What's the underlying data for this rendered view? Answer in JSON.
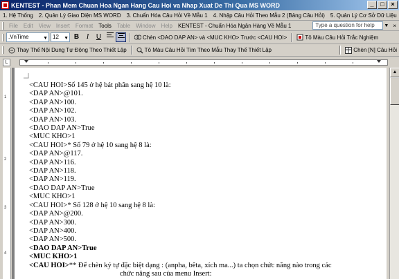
{
  "window": {
    "title": "KENTEST - Phan Mem Chuan Hoa Ngan Hang Cau Hoi va Nhap Xuat De Thi Qua MS WORD",
    "minimize": "_",
    "maximize": "□",
    "close": "×"
  },
  "menubar1": {
    "items": [
      "1. Hệ Thống",
      "2. Quản Lý Giao Diện MS WORD",
      "3. Chuẩn Hóa Câu Hỏi Về Mẫu 1",
      "4. Nhập Câu Hỏi Theo Mẫu 2 (Bảng Câu Hỏi)",
      "5. Quản Lý Cơ Sở Dữ Liệu"
    ]
  },
  "menubar2": {
    "items": [
      "File",
      "Edit",
      "View",
      "Insert",
      "Format",
      "Tools",
      "Table",
      "Window",
      "Help"
    ],
    "addin": "KENTEST - Chuẩn Hóa Ngân Hàng Về Mẫu 1",
    "help_placeholder": "Type a question for help",
    "close_doc": "×"
  },
  "formatting": {
    "font": ".VnTime",
    "size": "12",
    "bold": "B",
    "italic": "I",
    "underline": "U",
    "insert_label": "Chèn <DAO DAP AN> và <MUC KHO> Trước <CAU HOI>",
    "color_label": "Tô Màu Câu Hỏi Trắc Nghiệm"
  },
  "toolbar3": {
    "replace_label": "Thay Thế Nội Dung Tự Động Theo Thiết Lập",
    "color_find_label": "Tô Màu Câu Hỏi Tìm Theo Mẫu Thay Thế Thiết Lập",
    "insert_n_label": "Chèn [N] Câu Hỏi"
  },
  "vruler_labels": [
    "1",
    "2",
    "3",
    "4"
  ],
  "document": {
    "lines": [
      {
        "tag": "<CAU HOI>",
        "text": "Số 145 ở hệ bát phân sang hệ 10 là:"
      },
      {
        "tag": "<DAP AN>",
        "text": "@101."
      },
      {
        "tag": "<DAP AN>",
        "text": "100."
      },
      {
        "tag": "<DAP AN>",
        "text": "102."
      },
      {
        "tag": "<DAP AN>",
        "text": "103."
      },
      {
        "tag": "<DAO DAP AN>",
        "text": "True"
      },
      {
        "tag": "<MUC KHO>",
        "text": "1"
      },
      {
        "tag": "<CAU HOI>",
        "text": "* Số 79 ở hệ 10 sang hệ 8 là:"
      },
      {
        "tag": "<DAP AN>",
        "text": "@117."
      },
      {
        "tag": "<DAP AN>",
        "text": "116."
      },
      {
        "tag": "<DAP AN>",
        "text": "118."
      },
      {
        "tag": "<DAP AN>",
        "text": "119."
      },
      {
        "tag": "<DAO DAP AN>",
        "text": "True"
      },
      {
        "tag": "<MUC KHO>",
        "text": "1"
      },
      {
        "tag": "<CAU HOI>",
        "text": "* Số 128 ở hệ 10 sang hệ 8 là:"
      },
      {
        "tag": "<DAP AN>",
        "text": "@200."
      },
      {
        "tag": "<DAP AN>",
        "text": "300."
      },
      {
        "tag": "<DAP AN>",
        "text": "400."
      },
      {
        "tag": "<DAP AN>",
        "text": "500."
      },
      {
        "tag": "<DAO DAP AN>",
        "text": "True"
      },
      {
        "tag": "<MUC KHO>",
        "text": "1"
      },
      {
        "tag": "<CAU HOI>",
        "text": "** Để chèn ký tự đặc biệt dạng : (anpha, bêta, xích ma...)  ta chọn chức năng nào trong các"
      },
      {
        "tag": "",
        "text": "chức năng sau của menu Insert:"
      }
    ]
  }
}
